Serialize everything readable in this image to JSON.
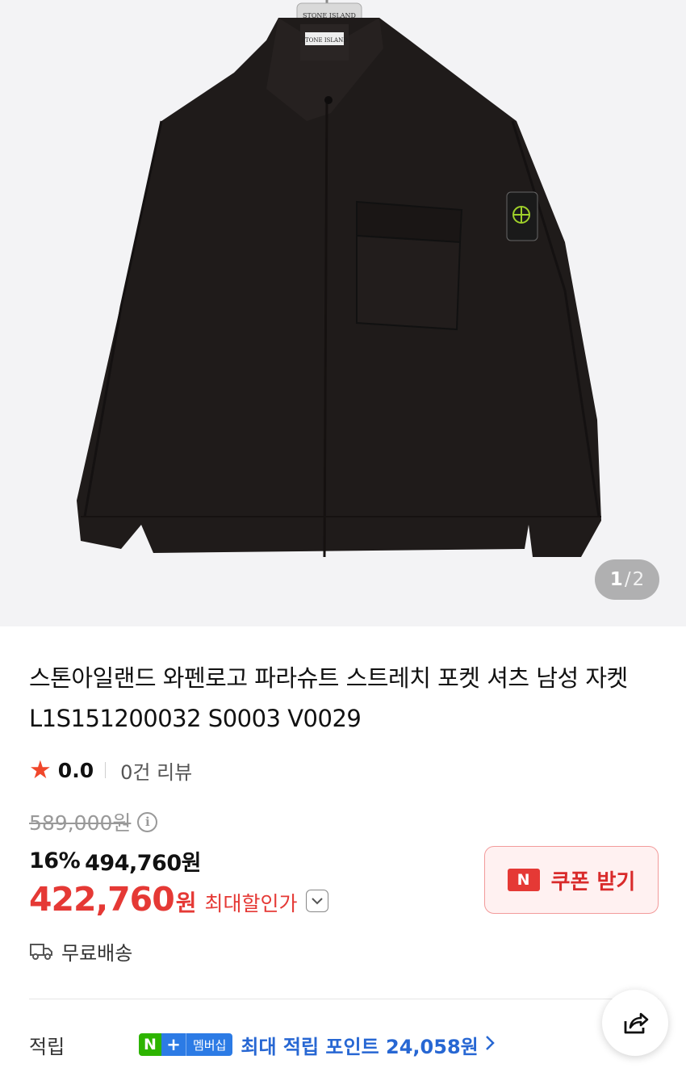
{
  "gallery": {
    "hanger_label": "STONE ISLAND",
    "collar_label": "STONE ISLAND",
    "current": "1",
    "separator": "/",
    "total": "2"
  },
  "product": {
    "title": "스톤아일랜드 와펜로고 파라슈트 스트레치 포켓 셔츠 남성 자켓 L1S151200032 S0003 V0029"
  },
  "rating": {
    "score": "0.0",
    "reviews": "0건 리뷰"
  },
  "price": {
    "original": "589,000원",
    "discount_pct": "16%",
    "sale": "494,760원",
    "max_price": "422,760",
    "max_won": "원",
    "max_label": "최대할인가"
  },
  "coupon": {
    "badge": "N",
    "label": "쿠폰 받기"
  },
  "shipping": {
    "label": "무료배송"
  },
  "points": {
    "label": "적립",
    "badge_n": "N",
    "badge_plus": "+",
    "badge_text": "멤버십",
    "text": "최대 적립 포인트 24,058원"
  },
  "colors": {
    "accent_red": "#e53935",
    "points_blue": "#2767d3",
    "naver_green": "#2db400"
  }
}
